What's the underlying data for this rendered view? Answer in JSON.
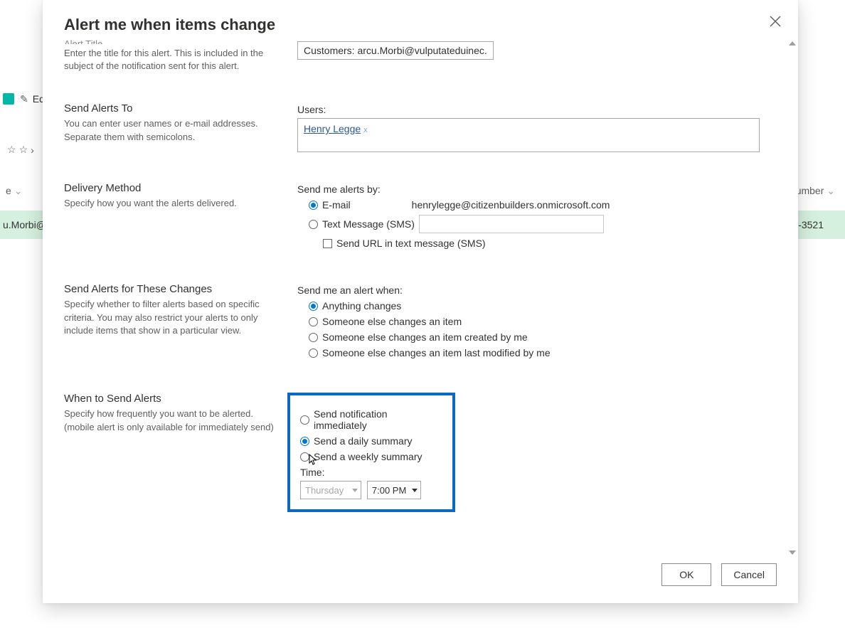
{
  "backdrop": {
    "edit_label": "Edi",
    "breadcrumb_star": "☆",
    "breadcrumb_chevron": "›",
    "name_col": "e",
    "number_col": "umber",
    "row_left": "u.Morbi@",
    "row_right": "-3521"
  },
  "modal": {
    "title": "Alert me when items change",
    "sections": {
      "alert_title": {
        "heading_cut": "Alert Title",
        "desc": "Enter the title for this alert. This is included in the subject of the notification sent for this alert.",
        "value": "Customers: arcu.Morbi@vulputateduinec."
      },
      "send_to": {
        "heading": "Send Alerts To",
        "desc": "You can enter user names or e-mail addresses. Separate them with semicolons.",
        "users_label": "Users:",
        "user_chip": "Henry Legge",
        "chip_x": "x"
      },
      "delivery": {
        "heading": "Delivery Method",
        "desc": "Specify how you want the alerts delivered.",
        "label": "Send me alerts by:",
        "opt_email": "E-mail",
        "email_addr": "henrylegge@citizenbuilders.onmicrosoft.com",
        "opt_sms": "Text Message (SMS)",
        "chk_url": "Send URL in text message (SMS)"
      },
      "changes": {
        "heading": "Send Alerts for These Changes",
        "desc": "Specify whether to filter alerts based on specific criteria. You may also restrict your alerts to only include items that show in a particular view.",
        "label": "Send me an alert when:",
        "opt1": "Anything changes",
        "opt2": "Someone else changes an item",
        "opt3": "Someone else changes an item created by me",
        "opt4": "Someone else changes an item last modified by me"
      },
      "when": {
        "heading": "When to Send Alerts",
        "desc": "Specify how frequently you want to be alerted. (mobile alert is only available for immediately send)",
        "opt1": "Send notification immediately",
        "opt2": "Send a daily summary",
        "opt3": "Send a weekly summary",
        "time_label": "Time:",
        "day": "Thursday",
        "time": "7:00 PM"
      }
    },
    "footer": {
      "ok": "OK",
      "cancel": "Cancel"
    }
  }
}
